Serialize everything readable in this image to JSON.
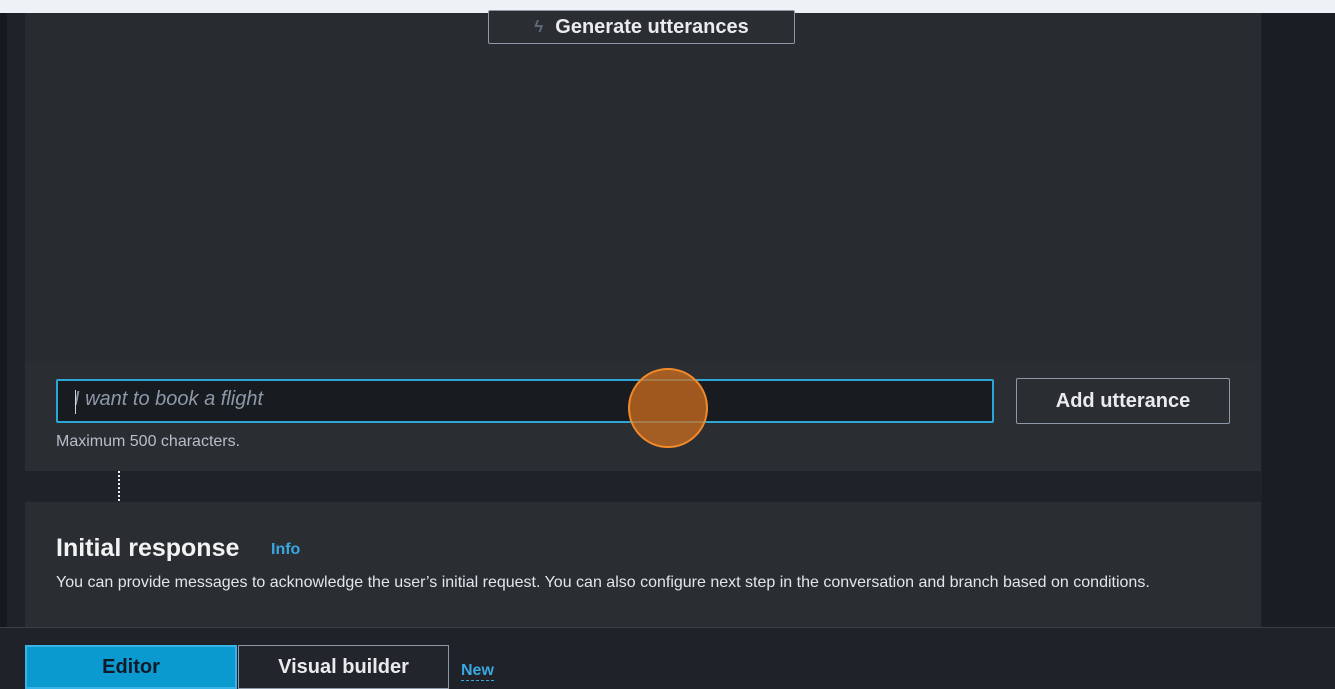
{
  "utterances": {
    "generate_button": "Generate utterances",
    "input_placeholder": "I want to book a flight",
    "add_button": "Add utterance",
    "hint": "Maximum 500 characters."
  },
  "initial_response": {
    "title": "Initial response",
    "info_link": "Info",
    "description": "You can provide messages to acknowledge the user’s initial request. You can also configure next step in the conversation and branch based on conditions."
  },
  "tabs": {
    "editor": "Editor",
    "visual_builder": "Visual builder",
    "new_badge": "New"
  },
  "icons": {
    "generate": "lightning-icon"
  },
  "colors": {
    "accent": "#39a7e0",
    "selected_tab": "#0a9ad0",
    "input_focus": "#2ba6d6",
    "click_marker": "#f08a2a"
  }
}
